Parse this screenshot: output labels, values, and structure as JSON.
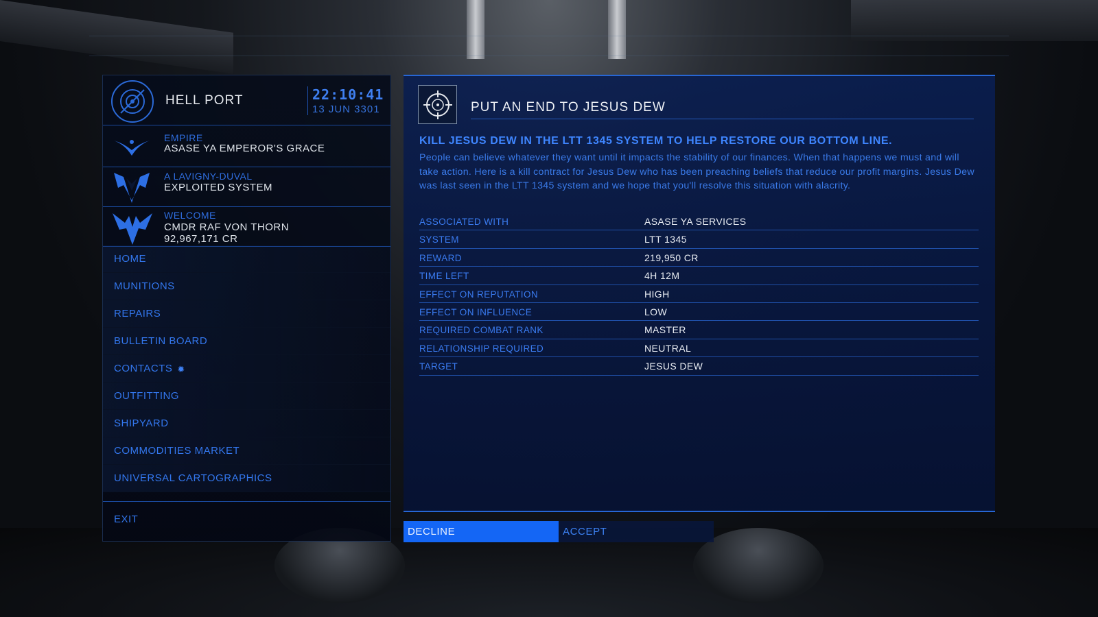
{
  "station": {
    "name": "HELL PORT",
    "time": "22:10:41",
    "date": "13 JUN 3301",
    "icon": "station-target-icon"
  },
  "info": [
    {
      "label": "EMPIRE",
      "value": "ASASE YA EMPEROR'S GRACE",
      "icon": "empire-eagle-icon"
    },
    {
      "label": "A LAVIGNY-DUVAL",
      "value": "EXPLOITED SYSTEM",
      "icon": "imperial-faction-icon"
    },
    {
      "label": "WELCOME",
      "value": "CMDR RAF VON THORN",
      "extra": "92,967,171 CR",
      "icon": "elite-rank-icon"
    }
  ],
  "nav": [
    "HOME",
    "MUNITIONS",
    "REPAIRS",
    "BULLETIN BOARD",
    "CONTACTS",
    "OUTFITTING",
    "SHIPYARD",
    "COMMODITIES MARKET",
    "UNIVERSAL CARTOGRAPHICS"
  ],
  "exit_label": "EXIT",
  "mission": {
    "icon": "crosshair-icon",
    "title": "PUT AN END TO JESUS DEW",
    "headline": "KILL JESUS DEW IN THE LTT 1345 SYSTEM TO HELP RESTORE OUR BOTTOM LINE.",
    "description": "People can believe whatever they want until it impacts the stability of our finances. When that happens we must and will take action. Here is a kill contract for Jesus Dew who has been preaching beliefs that reduce our profit margins. Jesus Dew was last seen in the  LTT 1345 system and we hope that you'll resolve this situation with alacrity.",
    "details": [
      {
        "key": "ASSOCIATED WITH",
        "value": "ASASE YA SERVICES"
      },
      {
        "key": "SYSTEM",
        "value": "LTT 1345"
      },
      {
        "key": "REWARD",
        "value": "219,950 CR"
      },
      {
        "key": "TIME LEFT",
        "value": "4H 12M"
      },
      {
        "key": "EFFECT ON REPUTATION",
        "value": "HIGH"
      },
      {
        "key": "EFFECT ON INFLUENCE",
        "value": "LOW"
      },
      {
        "key": "REQUIRED COMBAT RANK",
        "value": "MASTER"
      },
      {
        "key": "RELATIONSHIP REQUIRED",
        "value": "NEUTRAL"
      },
      {
        "key": "TARGET",
        "value": "JESUS DEW"
      }
    ]
  },
  "buttons": {
    "decline": "DECLINE",
    "accept": "ACCEPT"
  },
  "colors": {
    "accent": "#1466f5",
    "label_blue": "#3377ee",
    "panel_bg": "#0a1e50"
  }
}
